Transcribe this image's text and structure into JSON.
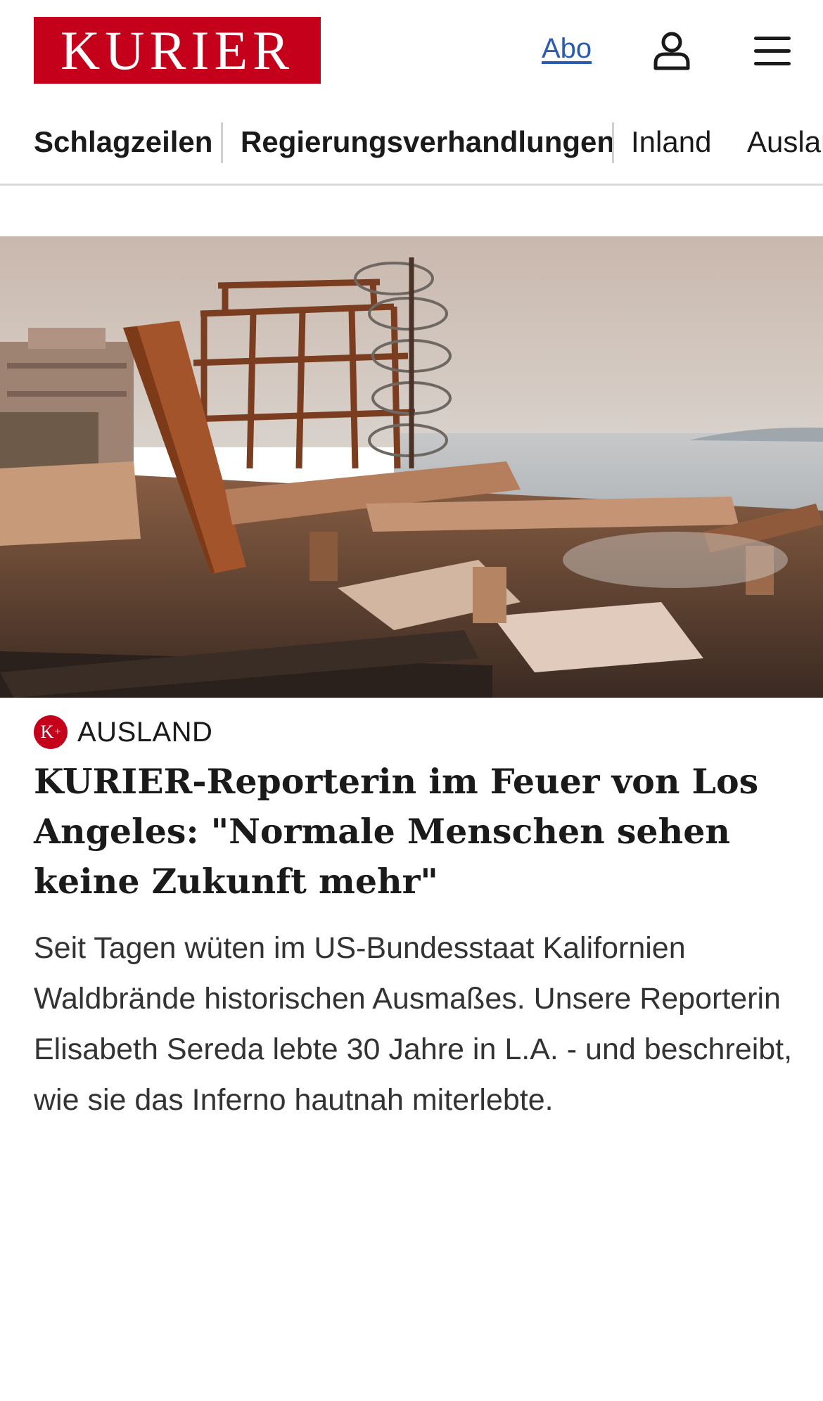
{
  "brand": {
    "logo_text": "KURIER",
    "color": "#c4001a"
  },
  "header": {
    "abo_label": "Abo",
    "link_color": "#2a5db0",
    "user_icon": "user-icon",
    "menu_icon": "hamburger-menu-icon"
  },
  "nav": {
    "items": [
      {
        "label": "Schlagzeilen"
      },
      {
        "label": "Regierungsverhandlungen"
      },
      {
        "label": "Inland"
      },
      {
        "label": "Ausland"
      }
    ]
  },
  "hero": {
    "image_alt": "Burned-out ruins of beachfront houses after the wildfire, metal frame and spiral staircase in front of the ocean"
  },
  "article": {
    "badge": "K+",
    "kicker": "AUSLAND",
    "headline": "KURIER-Reporterin im Feuer von Los Angeles: \"Normale Menschen sehen keine Zukunft mehr\"",
    "lead": "Seit Tagen wüten im US-Bundesstaat Kalifornien Waldbrände historischen Ausmaßes. Unsere Reporterin Elisabeth Sereda lebte 30 Jahre in L.A. - und beschreibt, wie sie das Inferno hautnah miterlebte."
  }
}
